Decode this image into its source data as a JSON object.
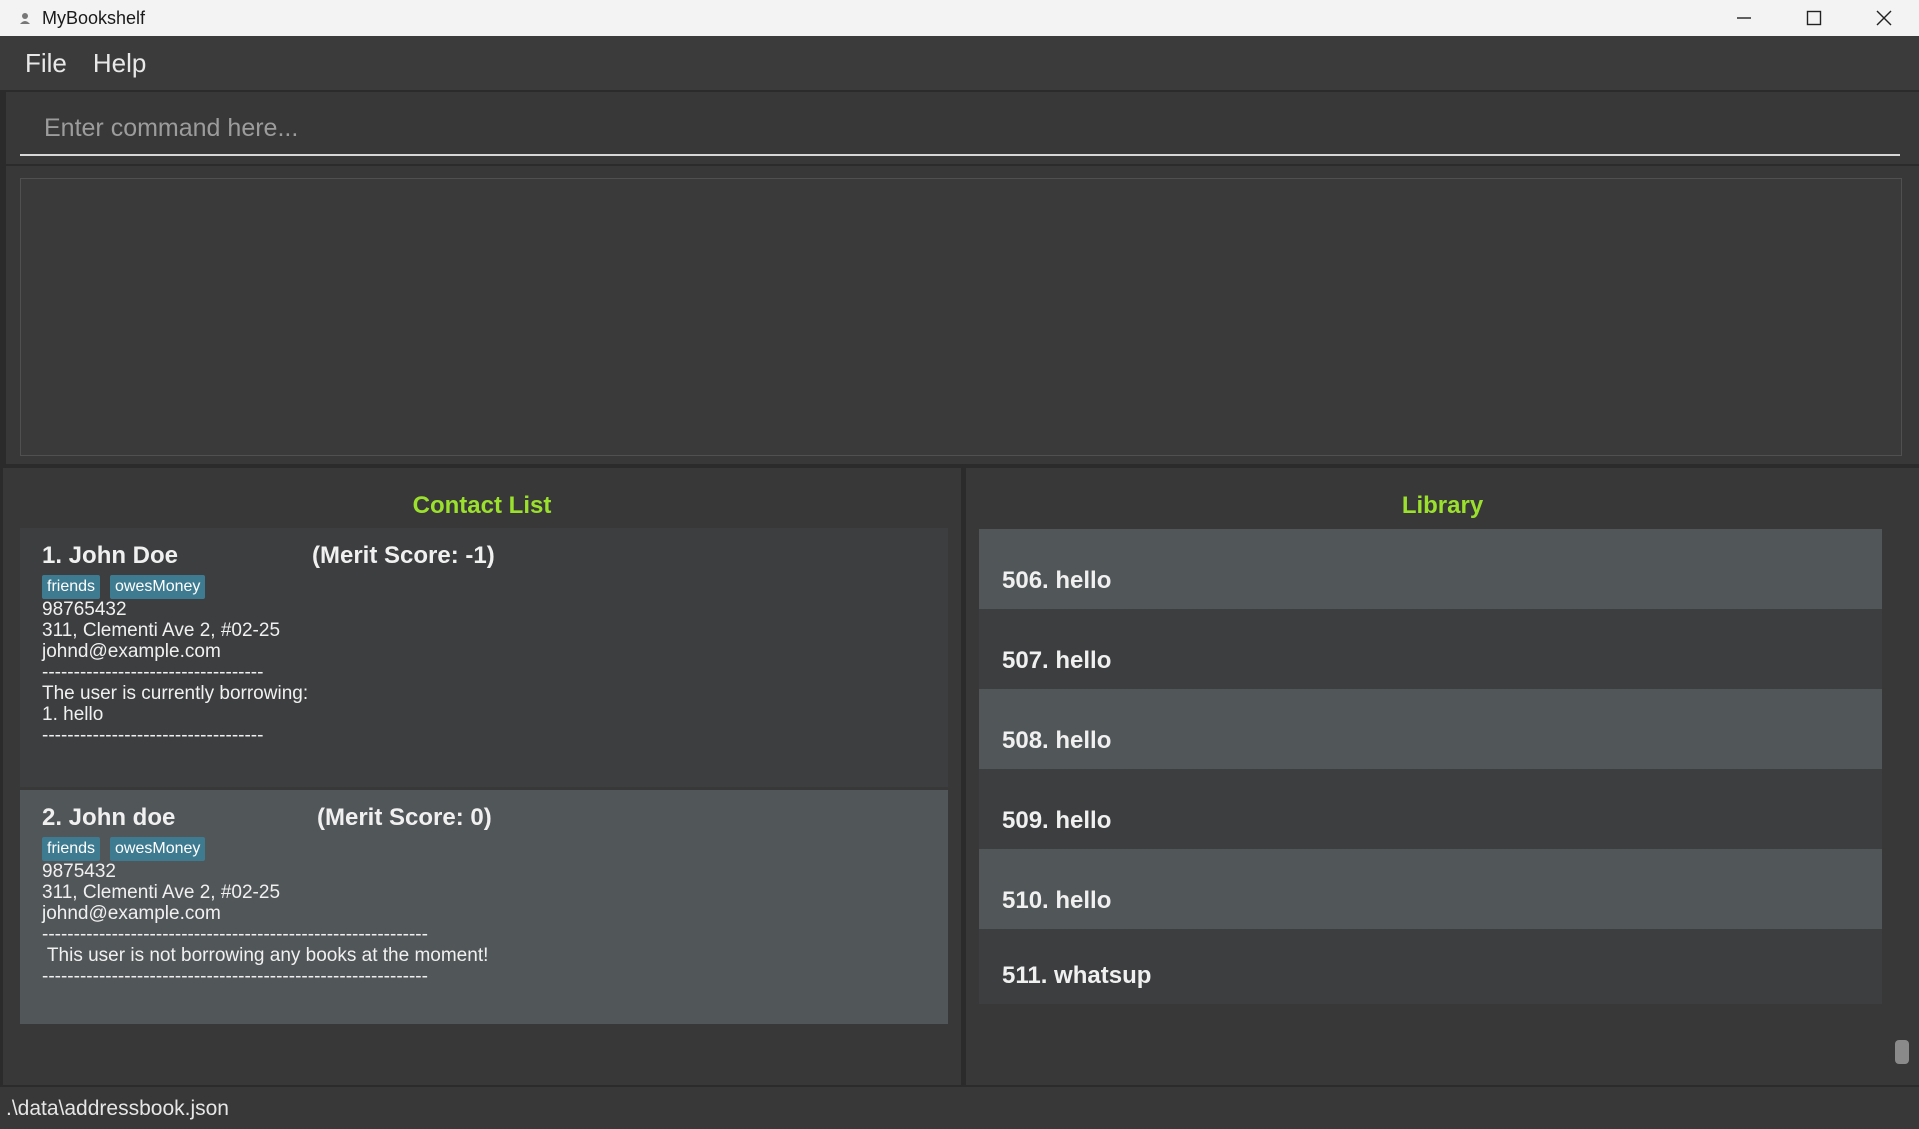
{
  "window": {
    "title": "MyBookshelf",
    "icon": "person-icon"
  },
  "menu": {
    "items": [
      "File",
      "Help"
    ]
  },
  "command": {
    "placeholder": "Enter command here..."
  },
  "contacts": {
    "title": "Contact List",
    "items": [
      {
        "name": "1.  John Doe",
        "merit": "(Merit Score: -1)",
        "tags": [
          "friends",
          "owesMoney"
        ],
        "phone": "98765432",
        "address": "311, Clementi Ave 2, #02-25",
        "email": "johnd@example.com",
        "separator": "-----------------------------------",
        "borrow_heading": "The user is currently borrowing:",
        "borrow_item": "1. hello",
        "separator_end": "-----------------------------------"
      },
      {
        "name": "2.  John doe",
        "merit": "(Merit Score: 0)",
        "tags": [
          "friends",
          "owesMoney"
        ],
        "phone": "9875432",
        "address": "311, Clementi Ave 2, #02-25",
        "email": "johnd@example.com",
        "separator": "-------------------------------------------------------------",
        "borrow_note": " This user is not borrowing any books at the moment!",
        "separator_end": "-------------------------------------------------------------"
      }
    ]
  },
  "library": {
    "title": "Library",
    "items": [
      "506. hello",
      "507. hello",
      "508. hello",
      "509. hello",
      "510. hello",
      "511. whatsup"
    ]
  },
  "status": {
    "path": ".\\data\\addressbook.json"
  },
  "colors": {
    "accent": "#9ae02d",
    "tag": "#3e7b91",
    "background": "#2b2b2b"
  }
}
